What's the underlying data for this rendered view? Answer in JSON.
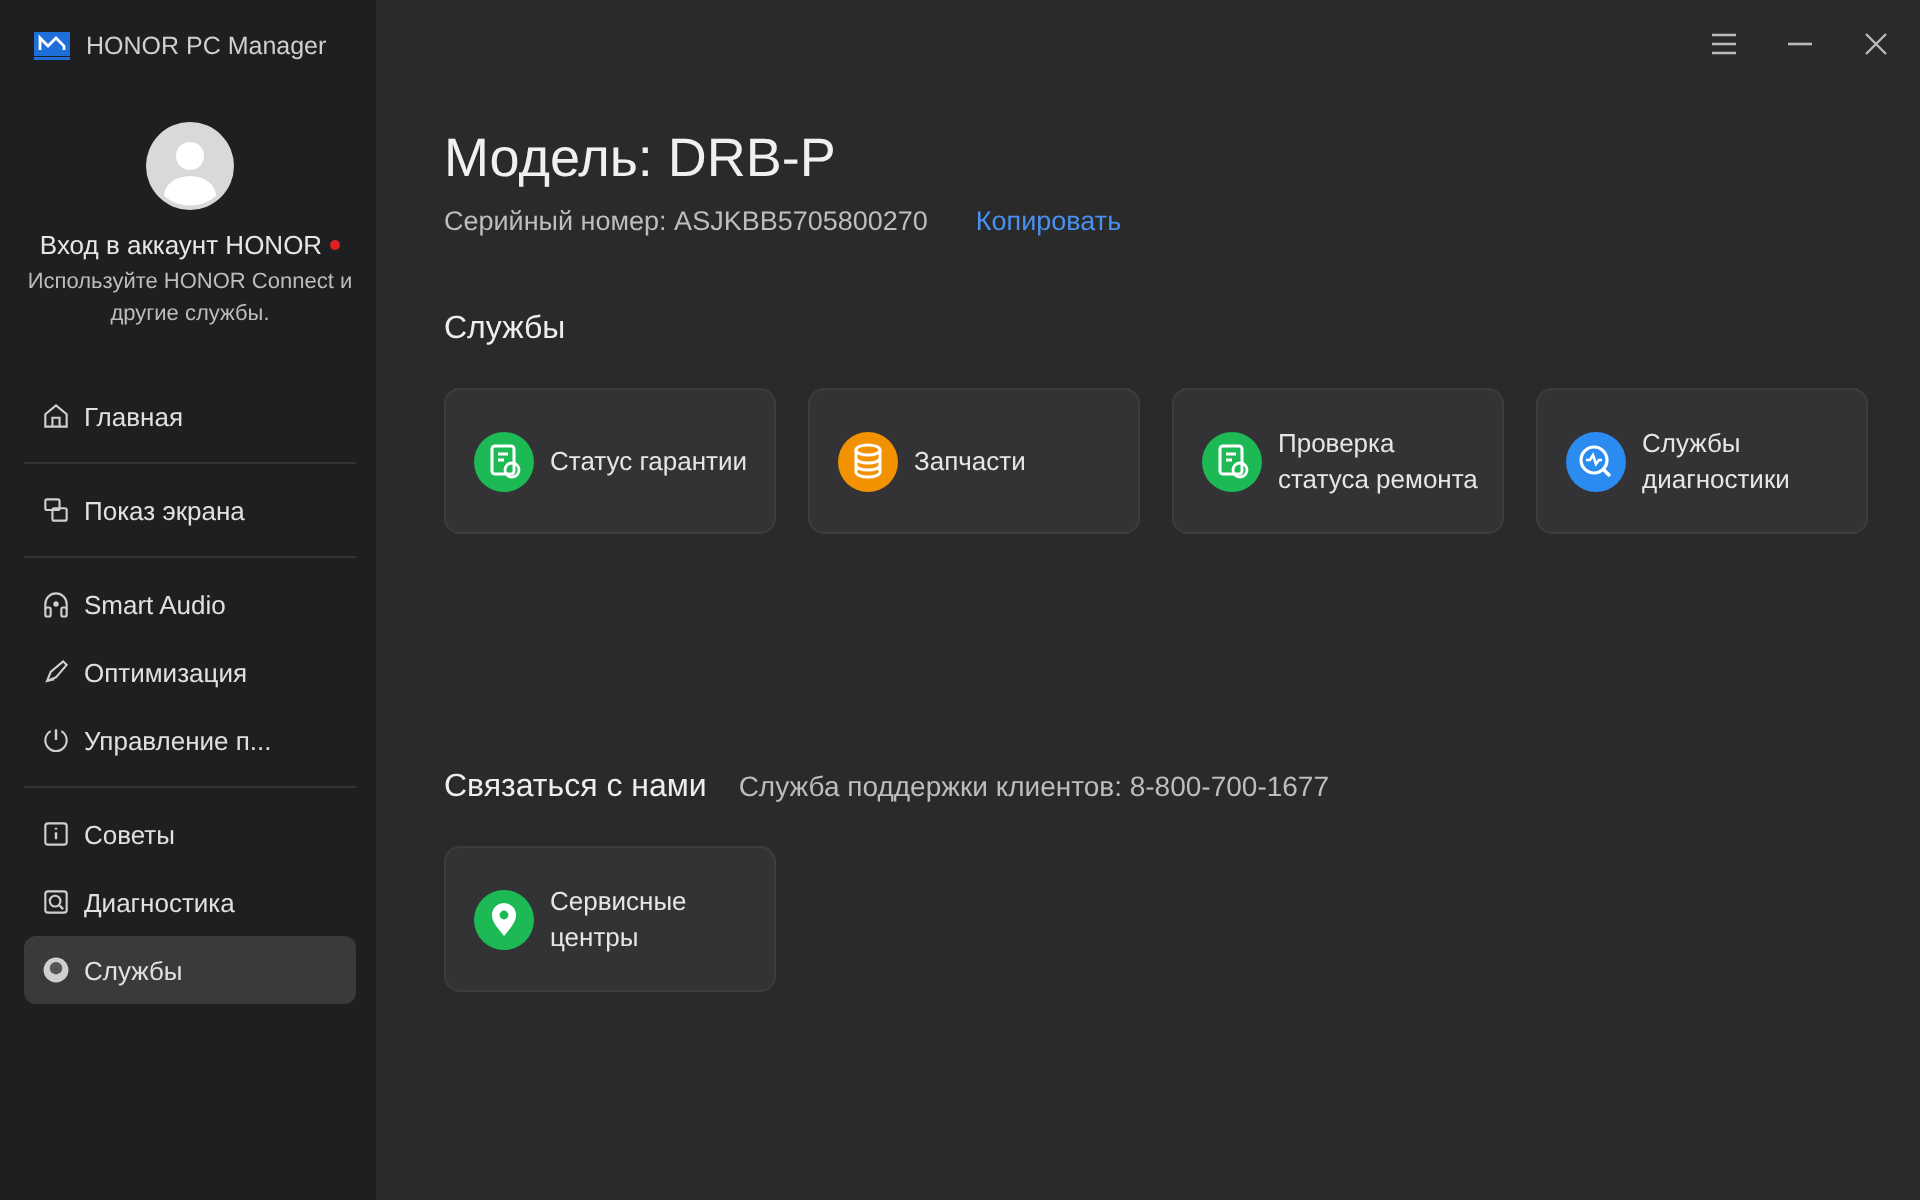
{
  "app": {
    "title": "HONOR PC Manager"
  },
  "account": {
    "title": "Вход в аккаунт HONOR",
    "notification": true,
    "subtitle": "Используйте HONOR Connect и другие службы."
  },
  "nav_groups": [
    {
      "items": [
        {
          "label": "Главная",
          "selected": false
        }
      ]
    },
    {
      "items": [
        {
          "label": "Показ экрана",
          "selected": false
        }
      ]
    },
    {
      "items": [
        {
          "label": "Smart Audio",
          "selected": false
        },
        {
          "label": "Оптимизация",
          "selected": false
        },
        {
          "label": "Управление п...",
          "selected": false
        }
      ]
    },
    {
      "items": [
        {
          "label": "Советы",
          "selected": false
        },
        {
          "label": "Диагностика",
          "selected": false
        },
        {
          "label": "Службы",
          "selected": true
        }
      ]
    }
  ],
  "device": {
    "model": "Модель: DRB-P",
    "serial": "Серийный номер: ASJKBB5705800270",
    "copy_link": "Копировать"
  },
  "services": {
    "heading": "Службы",
    "cards": [
      {
        "label": "Статус гарантии",
        "color": "#1db954",
        "kind": "document"
      },
      {
        "label": "Запчасти",
        "color": "#f39200",
        "kind": "coins"
      },
      {
        "label": "Проверка статуса ремонта",
        "color": "#1db954",
        "kind": "document"
      },
      {
        "label": "Службы диагностики",
        "color": "#2a8cf0",
        "kind": "diagnostics"
      }
    ]
  },
  "contact": {
    "heading": "Связаться с нами",
    "hotline": "Служба поддержки клиентов: 8-800-700-1677",
    "cards": [
      {
        "label": "Сервисные центры",
        "color": "#1db954",
        "kind": "location"
      }
    ]
  }
}
